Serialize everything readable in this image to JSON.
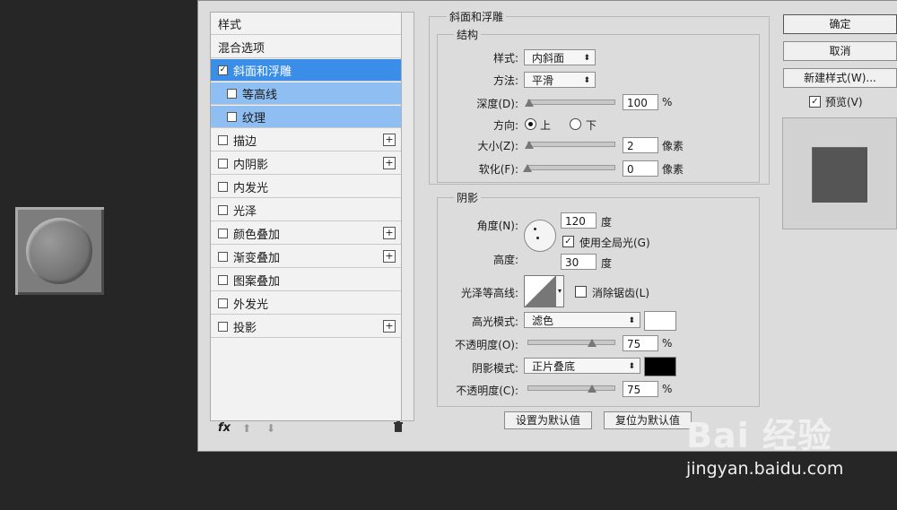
{
  "left_list": {
    "items": [
      {
        "label": "样式",
        "checkbox": false,
        "plus": false,
        "state": "normal"
      },
      {
        "label": "混合选项",
        "checkbox": false,
        "plus": false,
        "state": "normal"
      },
      {
        "label": "斜面和浮雕",
        "checkbox": true,
        "checked": true,
        "plus": false,
        "state": "selected"
      },
      {
        "label": "等高线",
        "checkbox": true,
        "checked": false,
        "plus": false,
        "state": "sub"
      },
      {
        "label": "纹理",
        "checkbox": true,
        "checked": false,
        "plus": false,
        "state": "sub"
      },
      {
        "label": "描边",
        "checkbox": true,
        "checked": false,
        "plus": true,
        "state": "normal"
      },
      {
        "label": "内阴影",
        "checkbox": true,
        "checked": false,
        "plus": true,
        "state": "normal"
      },
      {
        "label": "内发光",
        "checkbox": true,
        "checked": false,
        "plus": false,
        "state": "normal"
      },
      {
        "label": "光泽",
        "checkbox": true,
        "checked": false,
        "plus": false,
        "state": "normal"
      },
      {
        "label": "颜色叠加",
        "checkbox": true,
        "checked": false,
        "plus": true,
        "state": "normal"
      },
      {
        "label": "渐变叠加",
        "checkbox": true,
        "checked": false,
        "plus": true,
        "state": "normal"
      },
      {
        "label": "图案叠加",
        "checkbox": true,
        "checked": false,
        "plus": false,
        "state": "normal"
      },
      {
        "label": "外发光",
        "checkbox": true,
        "checked": false,
        "plus": false,
        "state": "normal"
      },
      {
        "label": "投影",
        "checkbox": true,
        "checked": false,
        "plus": true,
        "state": "normal"
      }
    ],
    "footer": {
      "fx": "fx",
      "up": "⬆",
      "down": "⬇",
      "trash": "🗑"
    }
  },
  "bevel": {
    "section_title": "斜面和浮雕",
    "structure_title": "结构",
    "style_label": "样式:",
    "style_value": "内斜面",
    "method_label": "方法:",
    "method_value": "平滑",
    "depth_label": "深度(D):",
    "depth_value": "100",
    "depth_unit": "%",
    "depth_level": 0.02,
    "direction_label": "方向:",
    "dir_up": "上",
    "dir_down": "下",
    "size_label": "大小(Z):",
    "size_value": "2",
    "size_unit": "像素",
    "size_level": 0.02,
    "soften_label": "软化(F):",
    "soften_value": "0",
    "soften_unit": "像素",
    "soften_level": 0.0
  },
  "shading": {
    "title": "阴影",
    "angle_label": "角度(N):",
    "angle_value": "120",
    "angle_unit": "度",
    "global_light_label": "使用全局光(G)",
    "altitude_label": "高度:",
    "altitude_value": "30",
    "altitude_unit": "度",
    "gloss_label": "光泽等高线:",
    "antialias_label": "消除锯齿(L)",
    "highlight_mode_label": "高光模式:",
    "highlight_mode_value": "滤色",
    "highlight_color": "#ffffff",
    "opacity_label": "不透明度(O):",
    "opacity_value": "75",
    "opacity_unit": "%",
    "opacity_level": 0.75,
    "shadow_mode_label": "阴影模式:",
    "shadow_mode_value": "正片叠底",
    "shadow_color": "#000000",
    "opacity2_label": "不透明度(C):",
    "opacity2_value": "75",
    "opacity2_unit": "%",
    "opacity2_level": 0.75
  },
  "buttons": {
    "set_default": "设置为默认值",
    "reset_default": "复位为默认值",
    "ok": "确定",
    "cancel": "取消",
    "new_style": "新建样式(W)...",
    "preview_label": "预览(V)"
  },
  "watermark": {
    "brand": "Bai 经验",
    "url": "jingyan.baidu.com"
  }
}
